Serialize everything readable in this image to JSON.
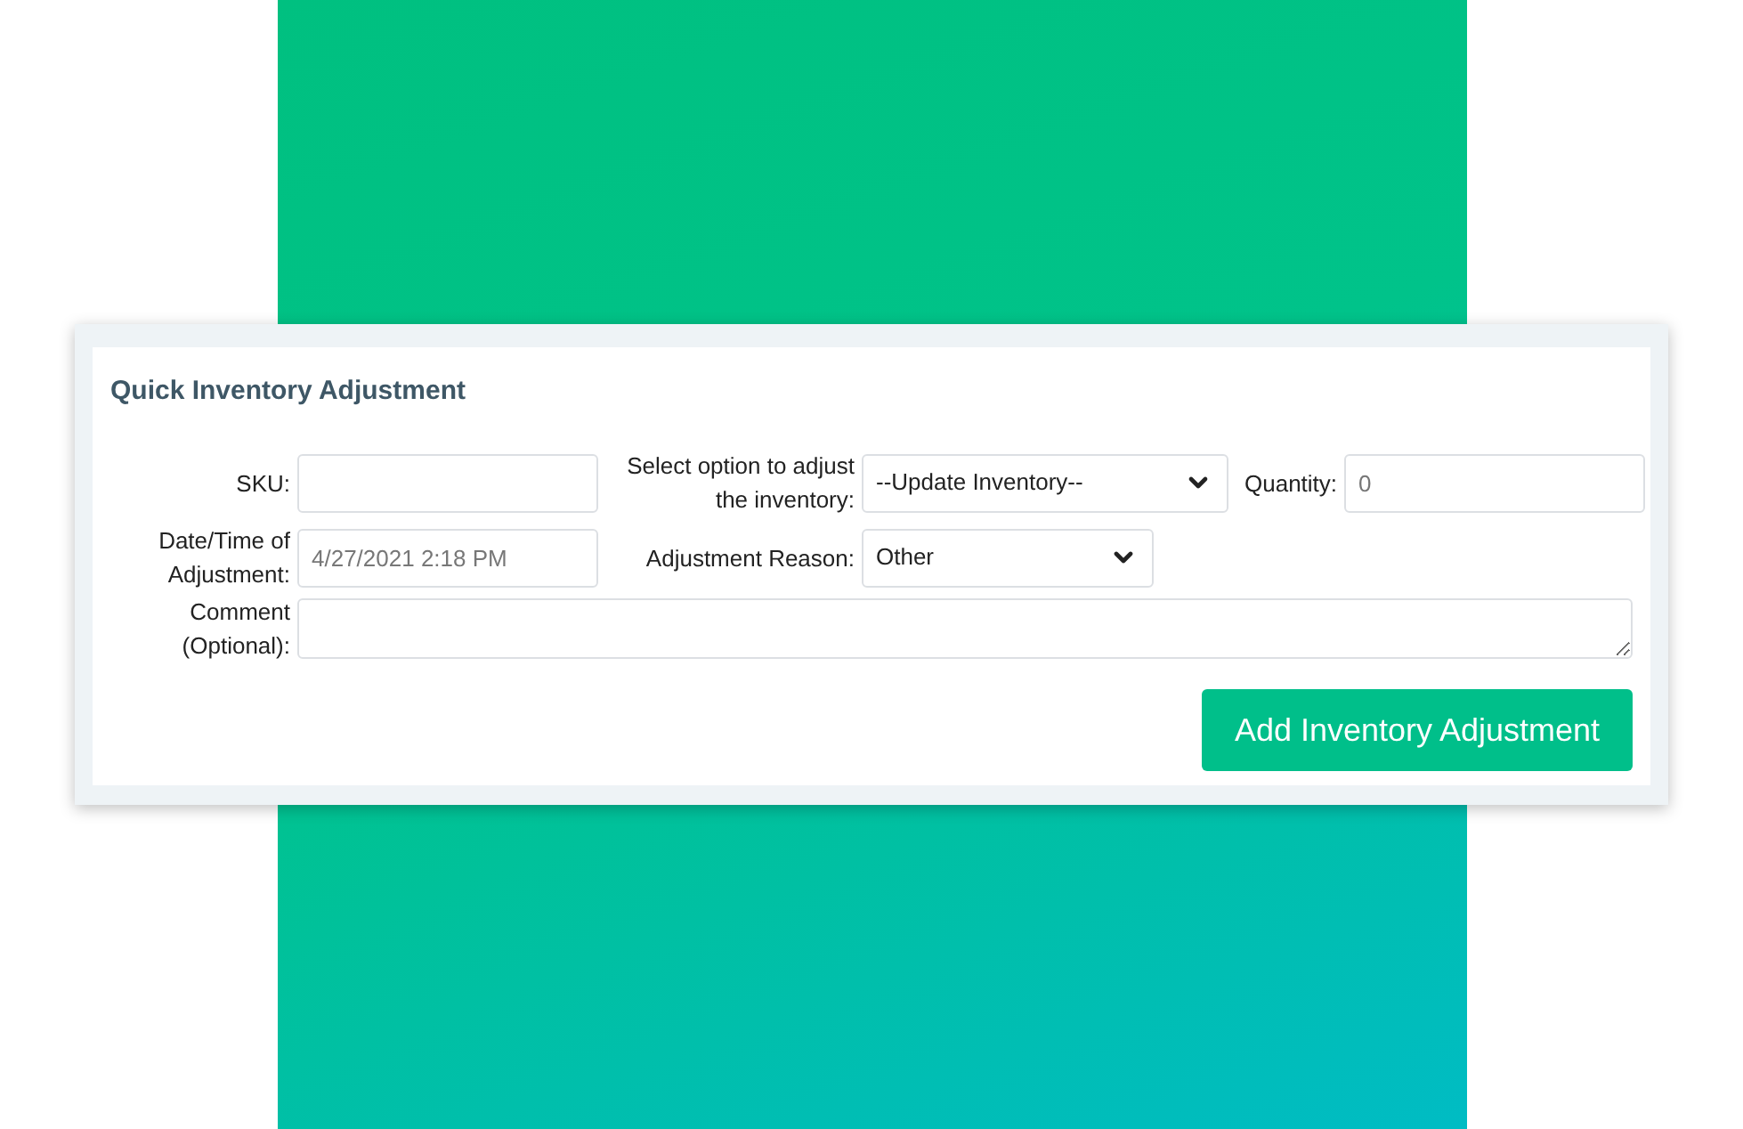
{
  "form": {
    "title": "Quick Inventory Adjustment",
    "sku": {
      "label": "SKU:"
    },
    "inventory_option": {
      "label": "Select option to adjust the inventory:",
      "value": "--Update Inventory--"
    },
    "quantity": {
      "label": "Quantity:",
      "placeholder": "0"
    },
    "date_time": {
      "label": "Date/Time of Adjustment:",
      "placeholder": "4/27/2021 2:18 PM"
    },
    "adjustment_reason": {
      "label": "Adjustment Reason:",
      "value": "Other"
    },
    "comment": {
      "label": "Comment (Optional):"
    },
    "submit_button": "Add Inventory Adjustment"
  }
}
